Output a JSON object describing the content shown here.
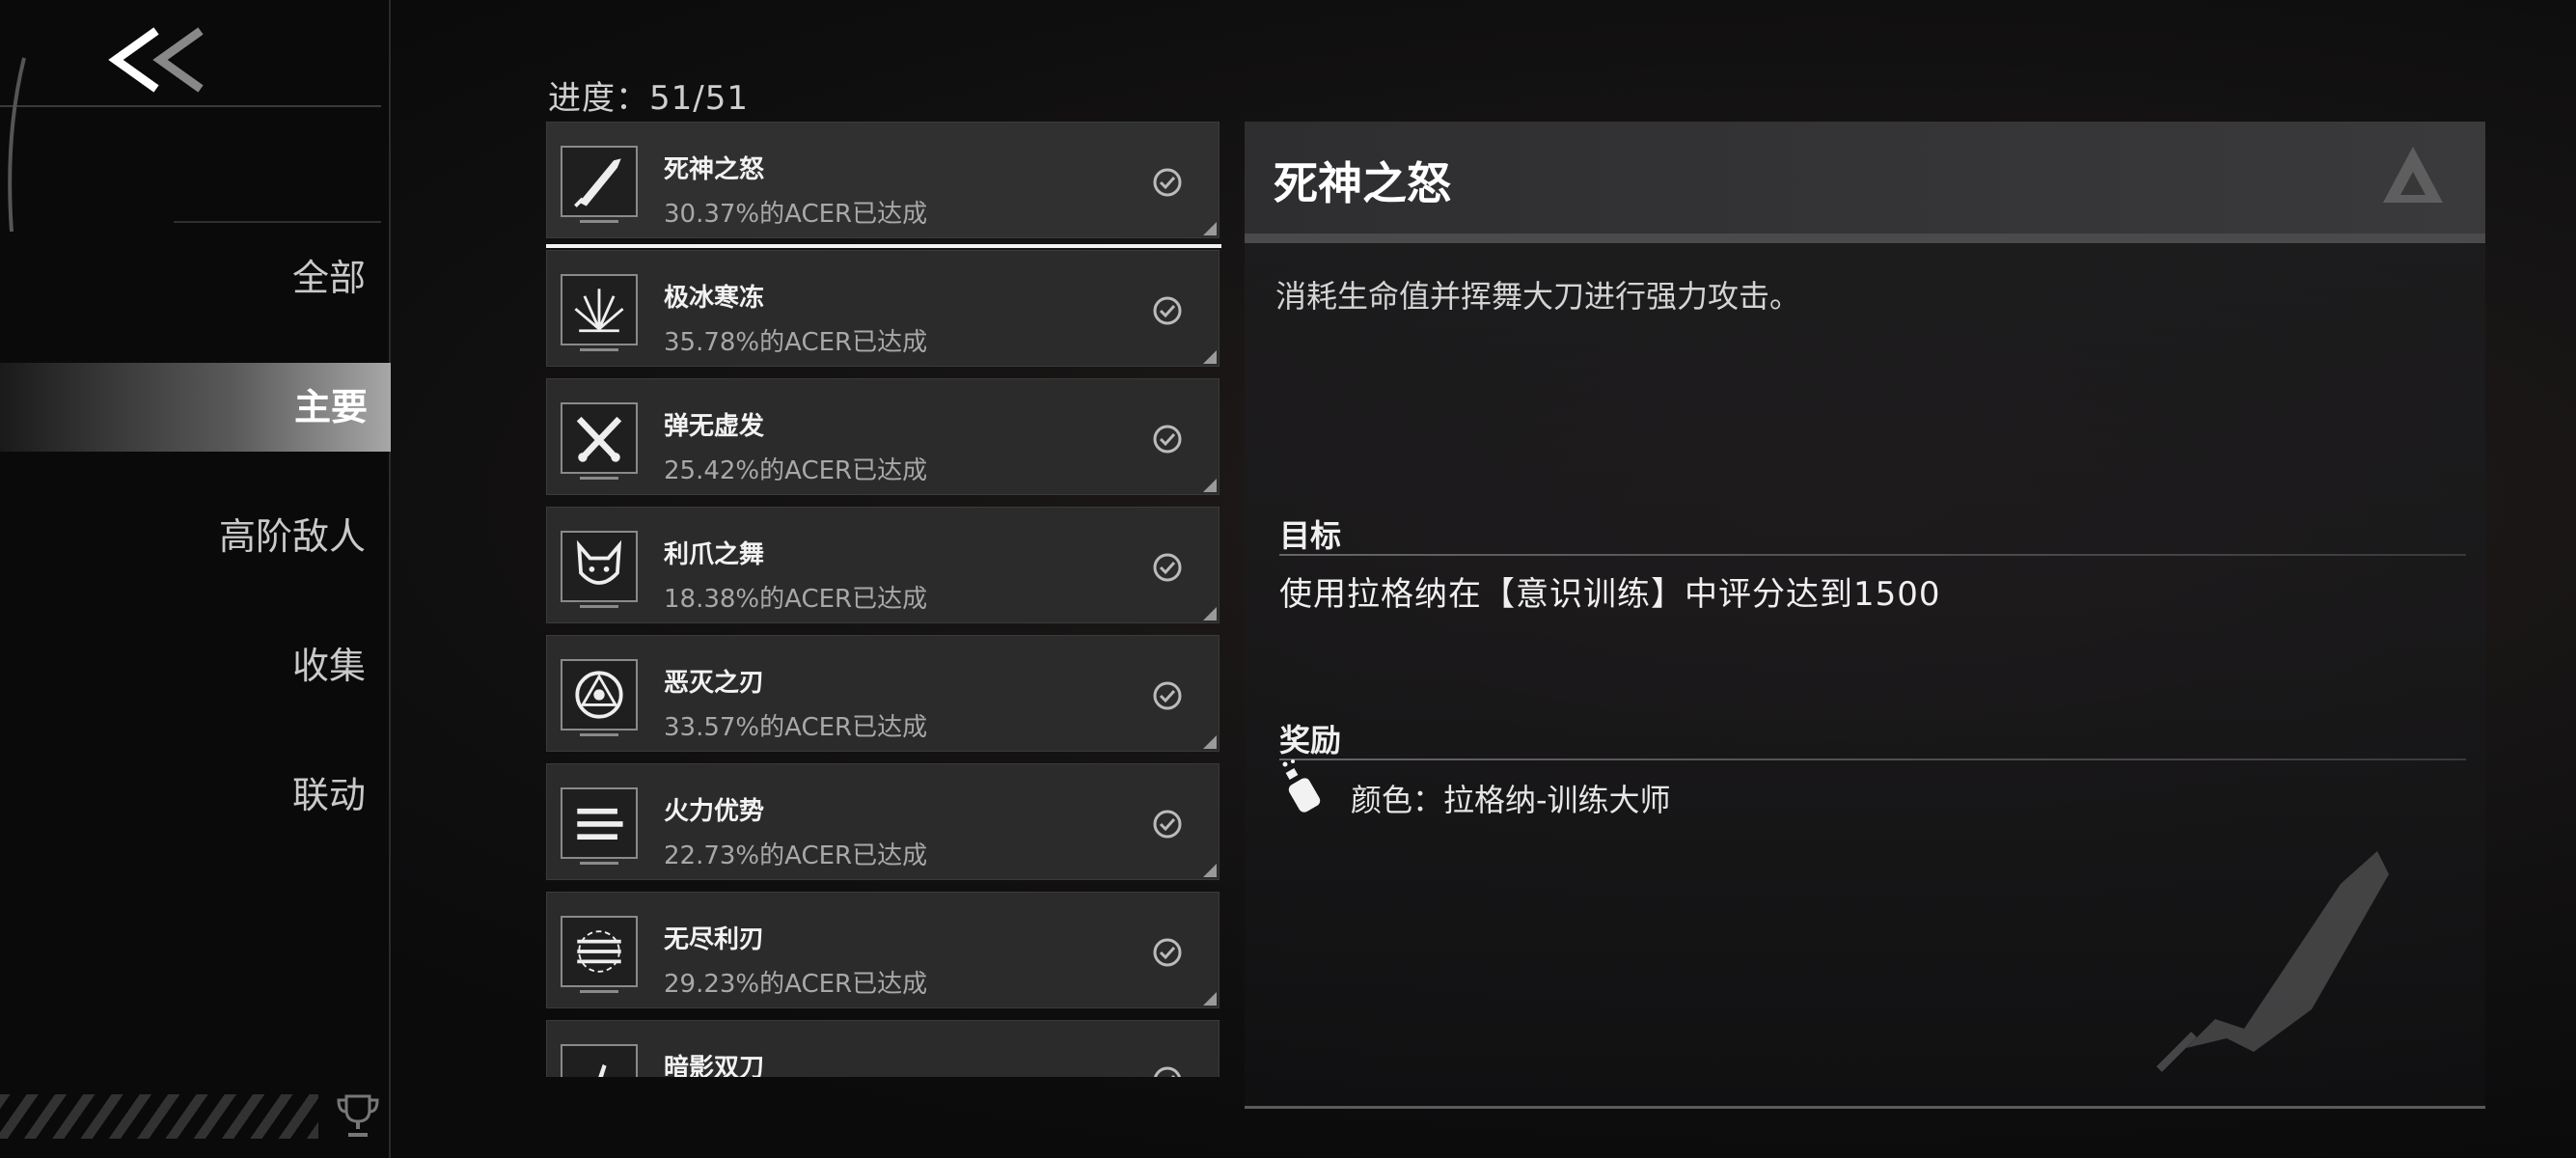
{
  "sidebar": {
    "back_icon": "double-chevron-left-icon",
    "items": [
      {
        "label": "全部",
        "active": false
      },
      {
        "label": "主要",
        "active": true
      },
      {
        "label": "高阶敌人",
        "active": false
      },
      {
        "label": "收集",
        "active": false
      },
      {
        "label": "联动",
        "active": false
      }
    ],
    "footer_icon": "trophy-icon"
  },
  "progress": {
    "text": "进度：51/51"
  },
  "achievements": [
    {
      "title": "死神之怒",
      "rate": "30.37%的ACER已达成",
      "icon": "greatsword-icon",
      "completed": true,
      "selected": true
    },
    {
      "title": "极冰寒冻",
      "rate": "35.78%的ACER已达成",
      "icon": "ice-crystal-icon",
      "completed": true
    },
    {
      "title": "弹无虚发",
      "rate": "25.42%的ACER已达成",
      "icon": "crossed-pistols-icon",
      "completed": true
    },
    {
      "title": "利爪之舞",
      "rate": "18.38%的ACER已达成",
      "icon": "fox-mask-icon",
      "completed": true
    },
    {
      "title": "恶灭之刃",
      "rate": "33.57%的ACER已达成",
      "icon": "sigil-circle-icon",
      "completed": true
    },
    {
      "title": "火力优势",
      "rate": "22.73%的ACER已达成",
      "icon": "missiles-icon",
      "completed": true
    },
    {
      "title": "无尽利刃",
      "rate": "29.23%的ACER已达成",
      "icon": "blade-ring-icon",
      "completed": true
    },
    {
      "title": "暗影双刀",
      "rate": "",
      "icon": "dual-blade-icon",
      "completed": true
    }
  ],
  "detail": {
    "title": "死神之怒",
    "description": "消耗生命值并挥舞大刀进行强力攻击。",
    "goal_label": "目标",
    "goal_text": "使用拉格纳在【意识训练】中评分达到1500",
    "reward_label": "奖励",
    "reward_text": "颜色：拉格纳-训练大师",
    "reward_icon": "paint-spray-icon",
    "art_icon": "greatsword-icon"
  },
  "colors": {
    "accent": "#f2f2f2",
    "card_bg": "#2b2b2c",
    "active_nav": "#a7a7a7"
  }
}
